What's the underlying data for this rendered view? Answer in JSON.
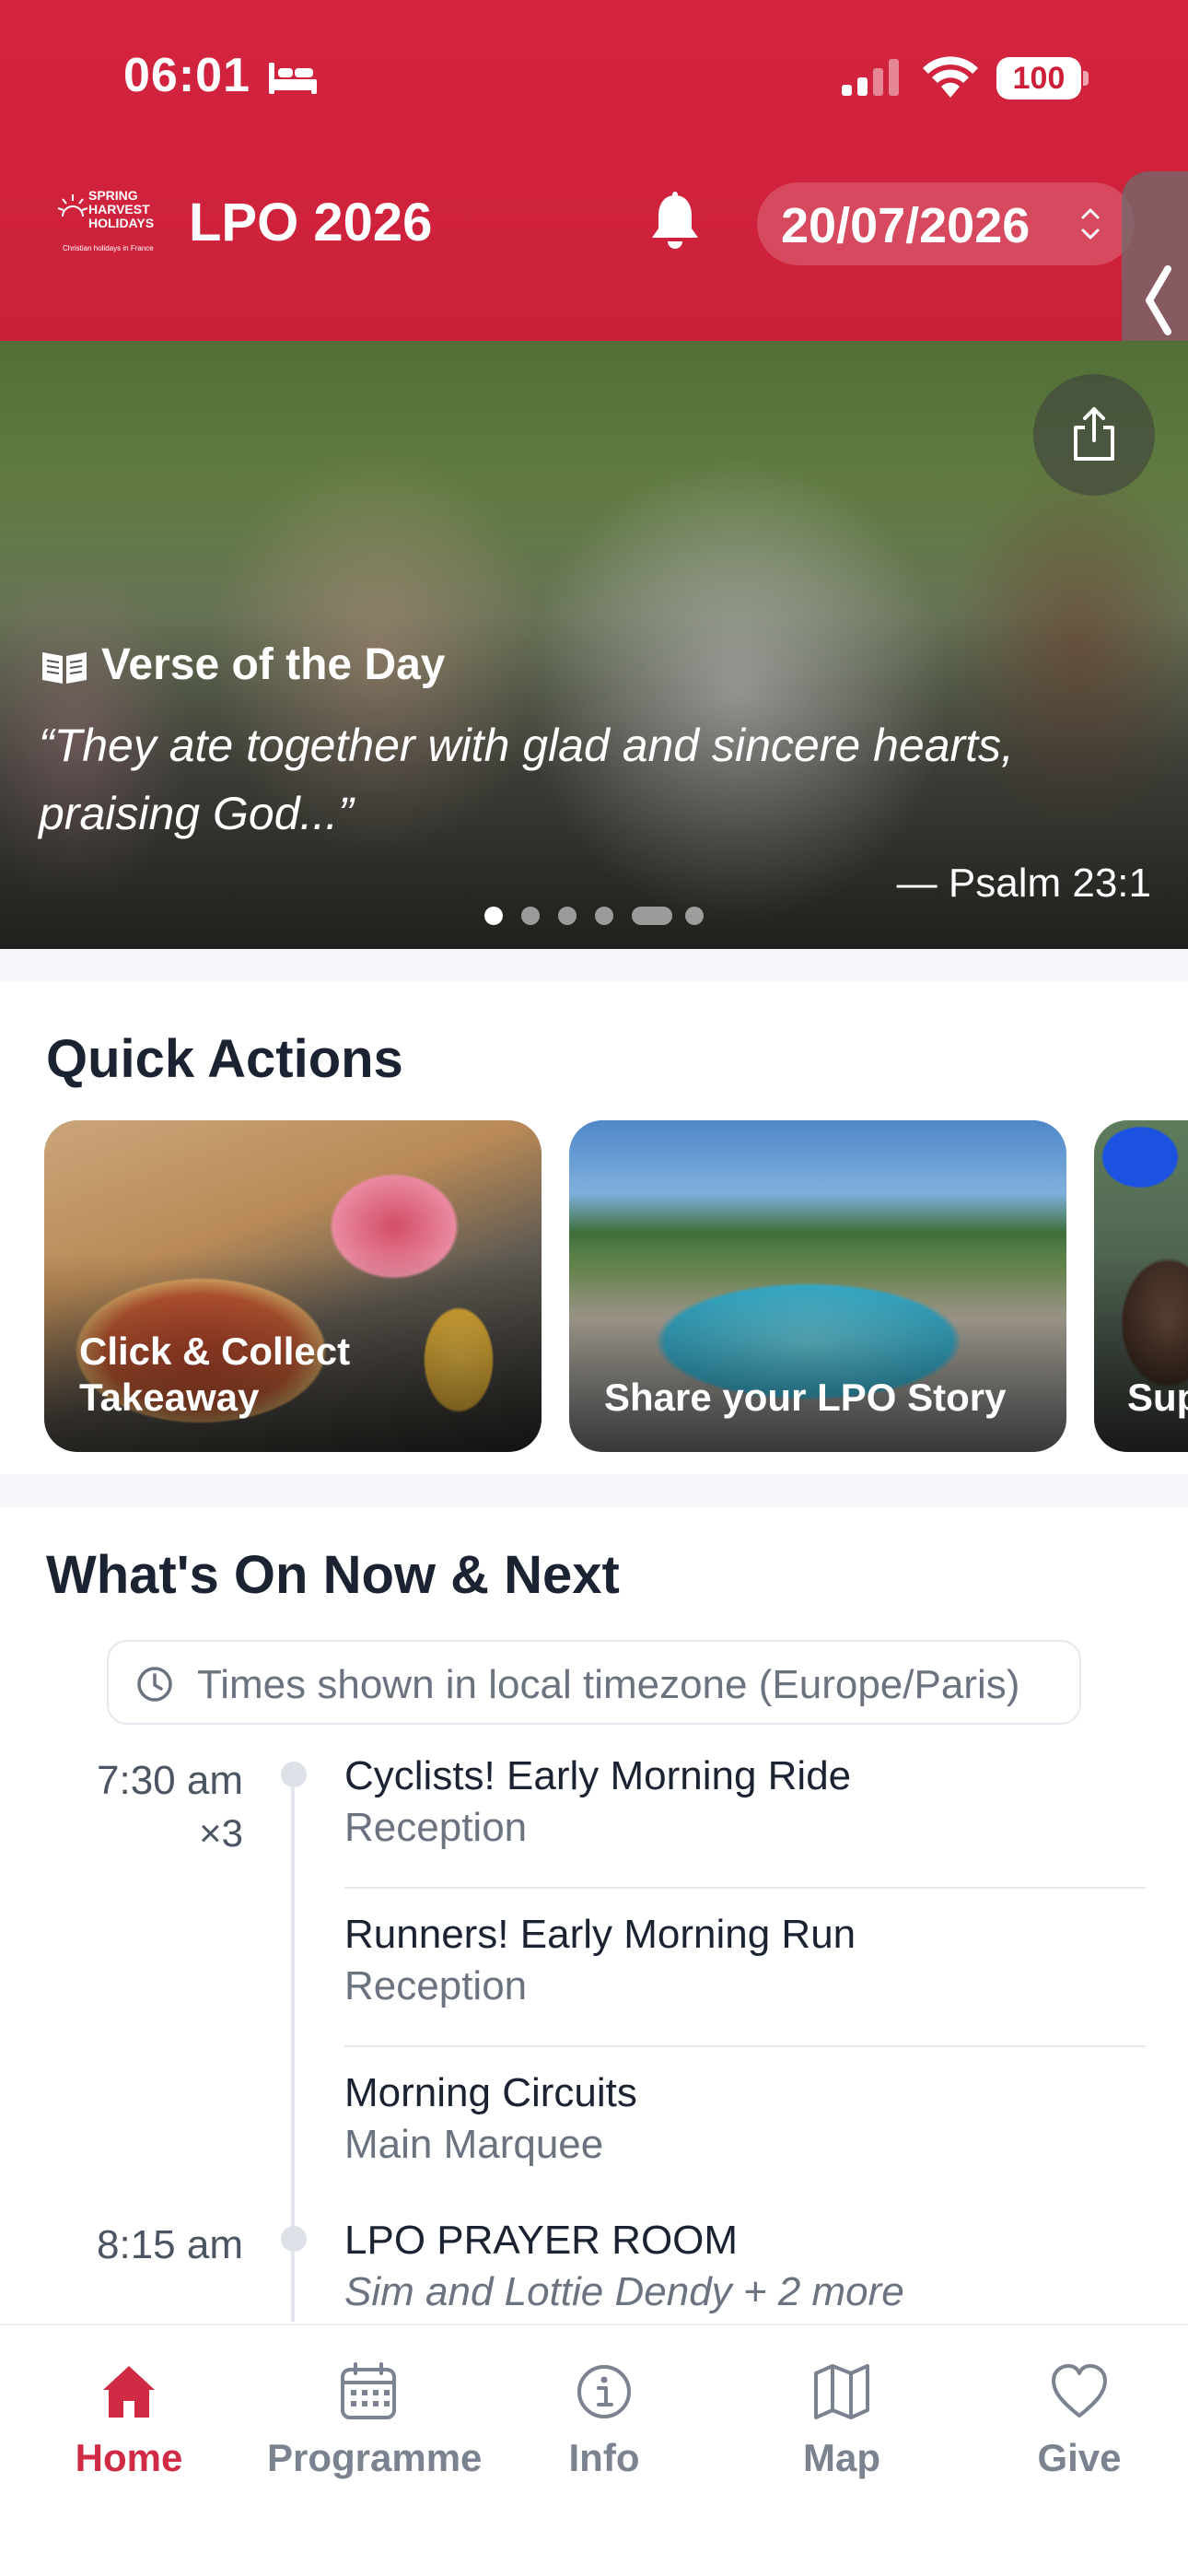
{
  "status_bar": {
    "time": "06:01",
    "battery": "100"
  },
  "header": {
    "logo_text": "SPRING HARVEST HOLIDAYS",
    "logo_subtext": "Christian holidays in France",
    "title": "LPO 2026",
    "date": "20/07/2026"
  },
  "hero": {
    "heading": "Verse of the Day",
    "verse": "“They ate together with glad and sincere hearts, praising God...”",
    "reference": "— Psalm 23:1"
  },
  "quick_actions": {
    "title": "Quick Actions",
    "cards": [
      {
        "label": "Click & Collect Takeaway"
      },
      {
        "label": "Share your LPO Story"
      },
      {
        "label": "Sup"
      }
    ]
  },
  "whats_on": {
    "title": "What's On Now & Next",
    "timezone_note": "Times shown in local timezone (Europe/Paris)",
    "groups": [
      {
        "time": "7:30 am",
        "count": "×3",
        "events": [
          {
            "title": "Cyclists! Early Morning Ride",
            "location": "Reception"
          },
          {
            "title": "Runners! Early Morning Run",
            "location": "Reception"
          },
          {
            "title": "Morning Circuits",
            "location": "Main Marquee"
          }
        ]
      },
      {
        "time": "8:15 am",
        "events": [
          {
            "title": "LPO PRAYER ROOM",
            "hosts": "Sim and Lottie Dendy + 2 more"
          }
        ]
      }
    ]
  },
  "nav": {
    "items": [
      {
        "label": "Home",
        "icon": "home-icon",
        "active": true
      },
      {
        "label": "Programme",
        "icon": "calendar-icon"
      },
      {
        "label": "Info",
        "icon": "info-icon"
      },
      {
        "label": "Map",
        "icon": "map-icon"
      },
      {
        "label": "Give",
        "icon": "heart-icon"
      }
    ]
  },
  "colors": {
    "brand_red": "#cc2039",
    "active_nav": "#d12a45",
    "text_dark": "#1b2333",
    "text_muted": "#6b7280"
  }
}
